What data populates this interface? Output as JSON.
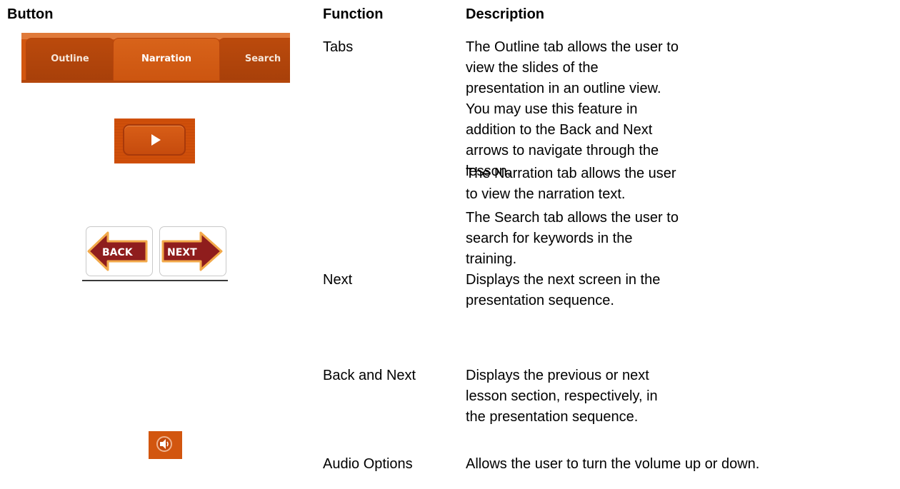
{
  "headers": {
    "button": "Button",
    "function": "Function",
    "description": "Description"
  },
  "rows": {
    "tabs": {
      "tab_labels": [
        "Outline",
        "Narration",
        "Search"
      ],
      "function": "Tabs",
      "descriptions": [
        "The Outline tab allows the user to view the slides of the presentation in an outline view. You may use this feature in addition to the Back and Next arrows to navigate through the lesson.",
        "The Narration tab allows the user to view the narration text.",
        "The Search tab allows the user to search for keywords in the training."
      ]
    },
    "next": {
      "icon": "play-icon",
      "function": "Next",
      "description": "Displays the next screen in the presentation sequence."
    },
    "back_next": {
      "back_label": "BACK",
      "next_label": "NEXT",
      "function": "Back and Next",
      "description": "Displays the previous or next lesson section, respectively, in the presentation sequence."
    },
    "audio": {
      "icon": "speaker-icon",
      "function": "Audio Options",
      "description": "Allows the user to turn the volume up or down."
    }
  },
  "colors": {
    "orange": "#d2560f",
    "dark_red": "#8f1d1d",
    "arrow_outline": "#f2a94a"
  }
}
